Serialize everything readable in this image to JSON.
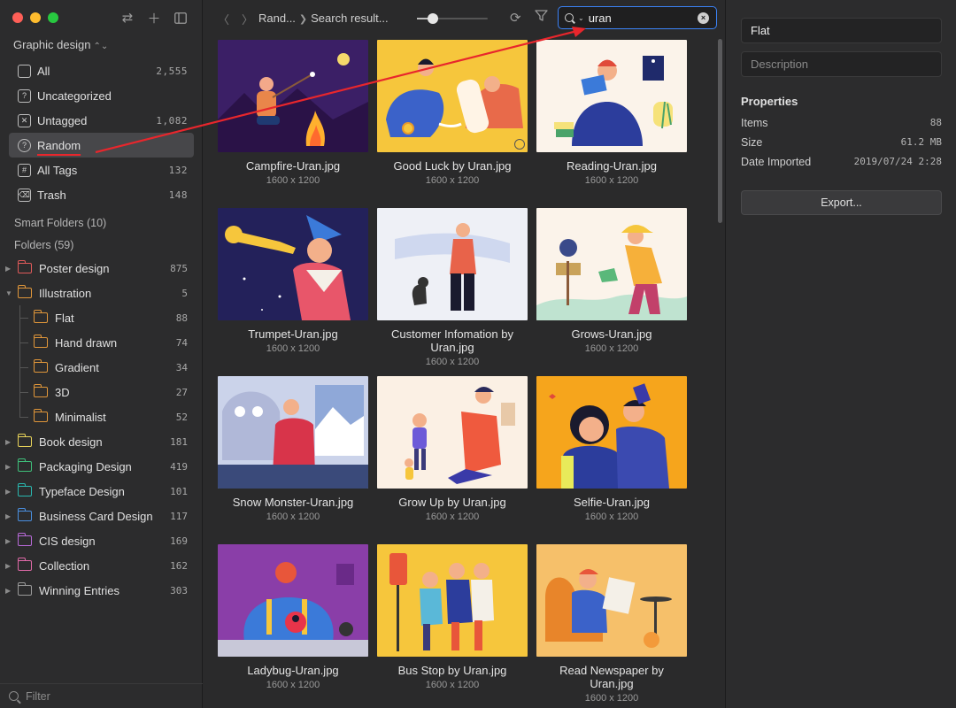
{
  "sidebar": {
    "library": "Graphic design",
    "nav": [
      {
        "label": "All",
        "count": "2,555",
        "icon": "stack-icon"
      },
      {
        "label": "Uncategorized",
        "count": "",
        "icon": "question-icon"
      },
      {
        "label": "Untagged",
        "count": "1,082",
        "icon": "untagged-icon"
      },
      {
        "label": "Random",
        "count": "",
        "icon": "bulb-icon"
      },
      {
        "label": "All Tags",
        "count": "132",
        "icon": "tag-icon"
      },
      {
        "label": "Trash",
        "count": "148",
        "icon": "trash-icon"
      }
    ],
    "smart_folders": "Smart Folders (10)",
    "folders_label": "Folders (59)",
    "folders": [
      {
        "label": "Poster design",
        "count": "875",
        "color": "#e05a5a",
        "level": 0,
        "open": false
      },
      {
        "label": "Illustration",
        "count": "5",
        "color": "#e0963a",
        "level": 0,
        "open": true
      },
      {
        "label": "Flat",
        "count": "88",
        "color": "#e0963a",
        "level": 1
      },
      {
        "label": "Hand drawn",
        "count": "74",
        "color": "#e0963a",
        "level": 1
      },
      {
        "label": "Gradient",
        "count": "34",
        "color": "#e0963a",
        "level": 1
      },
      {
        "label": "3D",
        "count": "27",
        "color": "#e0963a",
        "level": 1
      },
      {
        "label": "Minimalist",
        "count": "52",
        "color": "#e0963a",
        "level": 1
      },
      {
        "label": "Book design",
        "count": "181",
        "color": "#e8d35a",
        "level": 0,
        "open": false
      },
      {
        "label": "Packaging Design",
        "count": "419",
        "color": "#3fbf7a",
        "level": 0,
        "open": false
      },
      {
        "label": "Typeface Design",
        "count": "101",
        "color": "#2ab8b0",
        "level": 0,
        "open": false
      },
      {
        "label": "Business Card Design",
        "count": "117",
        "color": "#4a8fe0",
        "level": 0,
        "open": false
      },
      {
        "label": "CIS design",
        "count": "169",
        "color": "#b86ad8",
        "level": 0,
        "open": false
      },
      {
        "label": "Collection",
        "count": "162",
        "color": "#e06aa8",
        "level": 0,
        "open": false
      },
      {
        "label": "Winning Entries",
        "count": "303",
        "color": "#9a9a9a",
        "level": 0,
        "open": false
      }
    ],
    "filter_placeholder": "Filter"
  },
  "toolbar": {
    "crumb1": "Rand...",
    "crumb2": "Search result...",
    "search_value": "uran",
    "thumb_size": 0.22
  },
  "grid": [
    {
      "name": "Campfire-Uran.jpg",
      "dims": "1600 x 1200"
    },
    {
      "name": "Good Luck by Uran.jpg",
      "dims": "1600 x 1200"
    },
    {
      "name": "Reading-Uran.jpg",
      "dims": "1600 x 1200"
    },
    {
      "name": "Trumpet-Uran.jpg",
      "dims": "1600 x 1200"
    },
    {
      "name": "Customer Infomation by Uran.jpg",
      "dims": "1600 x 1200"
    },
    {
      "name": "Grows-Uran.jpg",
      "dims": "1600 x 1200"
    },
    {
      "name": "Snow Monster-Uran.jpg",
      "dims": "1600 x 1200"
    },
    {
      "name": "Grow Up by Uran.jpg",
      "dims": "1600 x 1200"
    },
    {
      "name": "Selfie-Uran.jpg",
      "dims": "1600 x 1200"
    },
    {
      "name": "Ladybug-Uran.jpg",
      "dims": "1600 x 1200"
    },
    {
      "name": "Bus Stop by Uran.jpg",
      "dims": "1600 x 1200"
    },
    {
      "name": "Read Newspaper by Uran.jpg",
      "dims": "1600 x 1200"
    }
  ],
  "inspector": {
    "name_value": "Flat",
    "description_placeholder": "Description",
    "properties_title": "Properties",
    "props": [
      {
        "k": "Items",
        "v": "88"
      },
      {
        "k": "Size",
        "v": "61.2 MB"
      },
      {
        "k": "Date Imported",
        "v": "2019/07/24 2:28"
      }
    ],
    "export_label": "Export..."
  },
  "colors": {
    "accent": "#3b82f6",
    "annotation": "#e8262c"
  }
}
